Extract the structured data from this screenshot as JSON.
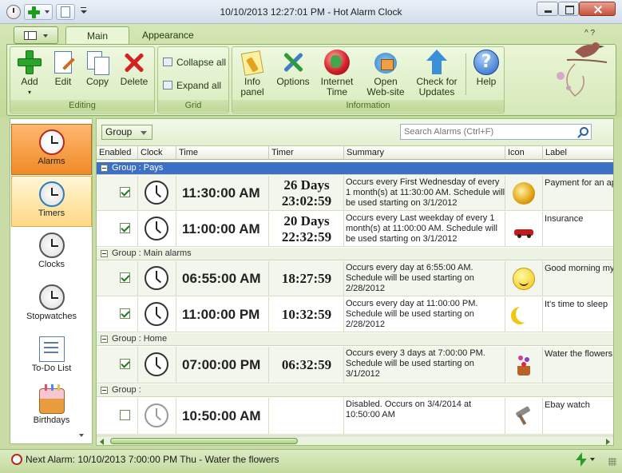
{
  "window": {
    "title": "10/10/2013 12:27:01 PM - Hot Alarm Clock"
  },
  "ribbon": {
    "tabs": [
      "Main Menu",
      "Appearance"
    ],
    "ribbon_controls": "^ ?",
    "groups": {
      "editing": {
        "label": "Editing",
        "buttons": [
          "Add",
          "Edit",
          "Copy",
          "Delete"
        ]
      },
      "grid": {
        "label": "Grid",
        "buttons": [
          "Collapse all",
          "Expand all"
        ]
      },
      "information": {
        "label": "Information",
        "buttons": [
          {
            "line1": "Info",
            "line2": "panel"
          },
          {
            "line1": "Options",
            "line2": ""
          },
          {
            "line1": "Internet",
            "line2": "Time"
          },
          {
            "line1": "Open",
            "line2": "Web-site"
          },
          {
            "line1": "Check for",
            "line2": "Updates"
          },
          {
            "line1": "Help",
            "line2": ""
          }
        ]
      }
    }
  },
  "sidebar": {
    "items": [
      "Alarms",
      "Timers",
      "Clocks",
      "Stopwatches",
      "To-Do List",
      "Birthdays"
    ],
    "active": "Alarms"
  },
  "toolbar": {
    "group_by": "Group",
    "search_placeholder": "Search Alarms (Ctrl+F)"
  },
  "grid": {
    "columns": [
      "Enabled",
      "Clock",
      "Time",
      "Timer",
      "Summary",
      "Icon",
      "Label"
    ],
    "groups": [
      {
        "title": "Group : Pays",
        "selected": true,
        "rows": [
          {
            "enabled": true,
            "time": "11:30:00 AM",
            "timer_days": "26 Days",
            "timer_time": "23:02:59",
            "summary": "Occurs every First Wednesday of every 1 month(s) at 11:30:00 AM. Schedule will be used starting on 3/1/2012",
            "icon": "coins-icon",
            "label": "Payment for an ap"
          },
          {
            "enabled": true,
            "time": "11:00:00 AM",
            "timer_days": "20 Days",
            "timer_time": "22:32:59",
            "summary": "Occurs every Last weekday of every 1 month(s) at 11:00:00 AM. Schedule will be used starting on 3/1/2012",
            "icon": "car-icon",
            "label": "Insurance"
          }
        ]
      },
      {
        "title": "Group : Main alarms",
        "selected": false,
        "rows": [
          {
            "enabled": true,
            "time": "06:55:00 AM",
            "timer_days": "",
            "timer_time": "18:27:59",
            "summary": "Occurs every day at 6:55:00 AM. Schedule will be used starting on 2/28/2012",
            "icon": "smiley-icon",
            "label": "Good morning my"
          },
          {
            "enabled": true,
            "time": "11:00:00 PM",
            "timer_days": "",
            "timer_time": "10:32:59",
            "summary": "Occurs every day at 11:00:00 PM. Schedule will be used starting on 2/28/2012",
            "icon": "moon-icon",
            "label": "It's time to sleep"
          }
        ]
      },
      {
        "title": "Group : Home",
        "selected": false,
        "rows": [
          {
            "enabled": true,
            "time": "07:00:00 PM",
            "timer_days": "",
            "timer_time": "06:32:59",
            "summary": "Occurs every 3 days at 7:00:00 PM. Schedule will be used starting on 3/1/2012",
            "icon": "flower-pot-icon",
            "label": "Water the flowers"
          }
        ]
      },
      {
        "title": "Group :",
        "selected": false,
        "rows": [
          {
            "enabled": false,
            "time": "10:50:00 AM",
            "timer_days": "",
            "timer_time": "",
            "summary": "Disabled. Occurs on 3/4/2014 at 10:50:00 AM",
            "icon": "gavel-icon",
            "label": "Ebay watch"
          }
        ]
      }
    ]
  },
  "statusbar": {
    "text": "Next Alarm: 10/10/2013 7:00:00 PM Thu - Water the flowers"
  },
  "colors": {
    "accent_green": "#c2d99a",
    "selected_group": "#3d6fc4",
    "active_sidebar": "#f08a28"
  }
}
